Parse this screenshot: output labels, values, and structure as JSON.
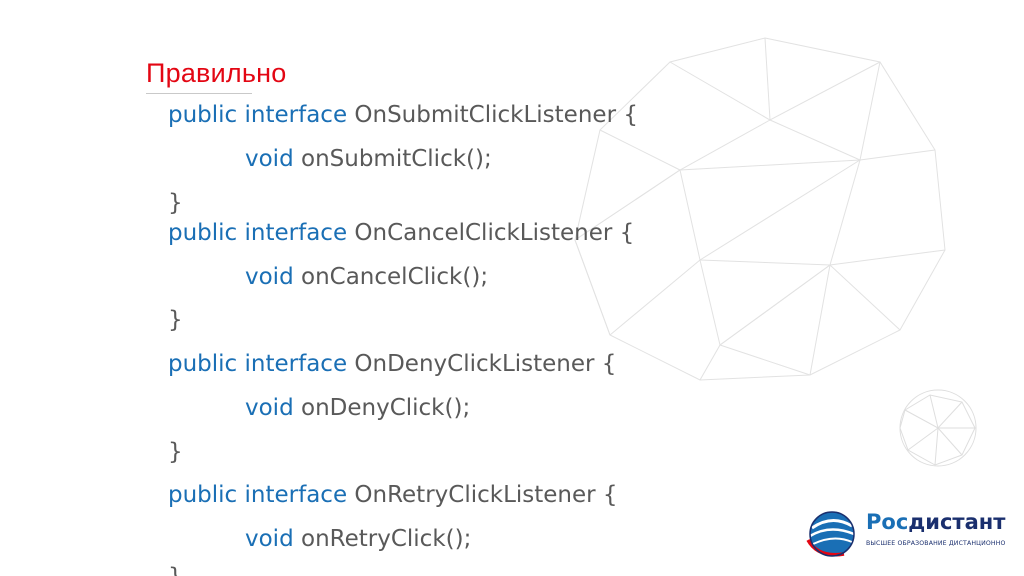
{
  "slide": {
    "title": "Правильно",
    "code_lines": [
      {
        "kw": "public interface",
        "rest": " OnSubmitClickListener {"
      },
      {
        "kw": "void",
        "rest": " onSubmitClick();"
      },
      {
        "kw": "",
        "rest": "}"
      },
      {
        "kw": "public interface",
        "rest": " OnCancelClickListener {"
      },
      {
        "kw": "void",
        "rest": " onCancelClick();"
      },
      {
        "kw": "",
        "rest": "}"
      },
      {
        "kw": "public interface",
        "rest": " OnDenyClickListener {"
      },
      {
        "kw": "void",
        "rest": " onDenyClick();"
      },
      {
        "kw": "",
        "rest": "}"
      },
      {
        "kw": "public interface",
        "rest": " OnRetryClickListener {"
      },
      {
        "kw": "void",
        "rest": " onRetryClick();"
      },
      {
        "kw": "",
        "rest": "}"
      }
    ]
  },
  "logo": {
    "name_part1": "Рос",
    "name_part2": "дистант",
    "tagline": "ВЫСШЕЕ ОБРАЗОВАНИЕ ДИСТАНЦИОННО"
  },
  "colors": {
    "title": "#e30613",
    "keyword": "#1a6fb5",
    "code_text": "#595959",
    "logo_dark": "#1a2f6e",
    "logo_light": "#1a6fb5"
  }
}
